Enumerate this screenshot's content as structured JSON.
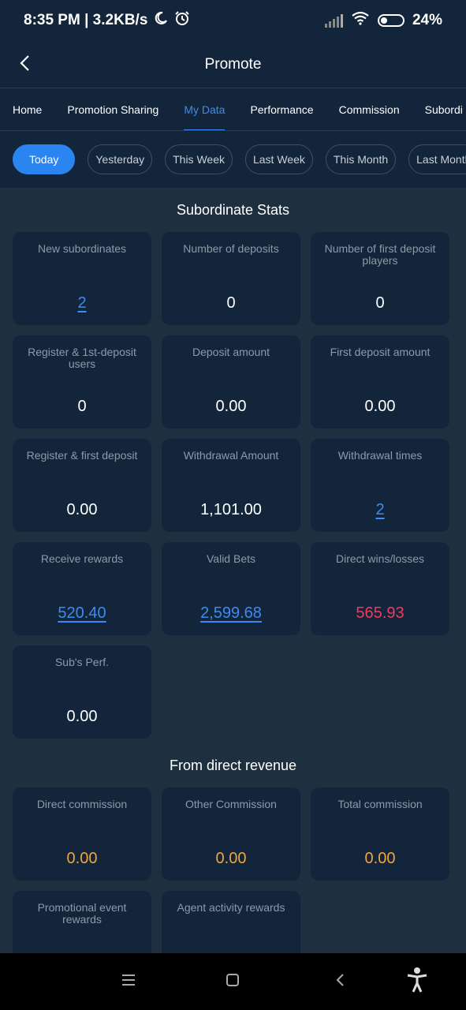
{
  "status_bar": {
    "time_speed": "8:35 PM | 3.2KB/s",
    "battery": "24%",
    "moon_icon": "moon-icon",
    "alarm_icon": "alarm-icon",
    "signal_icon": "signal-icon",
    "wifi_icon": "wifi-icon"
  },
  "header": {
    "title": "Promote"
  },
  "tabs": [
    {
      "label": "Home"
    },
    {
      "label": "Promotion Sharing"
    },
    {
      "label": "My Data",
      "active": true
    },
    {
      "label": "Performance"
    },
    {
      "label": "Commission"
    },
    {
      "label": "Subordi"
    }
  ],
  "filters": [
    {
      "label": "Today",
      "active": true
    },
    {
      "label": "Yesterday"
    },
    {
      "label": "This Week"
    },
    {
      "label": "Last Week"
    },
    {
      "label": "This Month"
    },
    {
      "label": "Last Month"
    }
  ],
  "subordinate_stats": {
    "title": "Subordinate Stats",
    "cards": [
      {
        "label": "New subordinates",
        "value": "2"
      },
      {
        "label": "Number of deposits",
        "value": "0"
      },
      {
        "label": "Number of first deposit players",
        "value": "0"
      },
      {
        "label": "Register & 1st-deposit users",
        "value": "0"
      },
      {
        "label": "Deposit amount",
        "value": "0.00"
      },
      {
        "label": "First deposit amount",
        "value": "0.00"
      },
      {
        "label": "Register & first deposit",
        "value": "0.00"
      },
      {
        "label": "Withdrawal Amount",
        "value": "1,101.00"
      },
      {
        "label": "Withdrawal times",
        "value": "2"
      },
      {
        "label": "Receive rewards",
        "value": "520.40"
      },
      {
        "label": "Valid Bets",
        "value": "2,599.68"
      },
      {
        "label": "Direct wins/losses",
        "value": "565.93"
      },
      {
        "label": "Sub's Perf.",
        "value": "0.00"
      }
    ]
  },
  "direct_revenue": {
    "title": "From direct revenue",
    "cards": [
      {
        "label": "Direct commission",
        "value": "0.00"
      },
      {
        "label": "Other Commission",
        "value": "0.00"
      },
      {
        "label": "Total commission",
        "value": "0.00"
      },
      {
        "label": "Promotional event rewards",
        "value": ""
      },
      {
        "label": "Agent activity rewards",
        "value": ""
      }
    ]
  },
  "colors": {
    "accent": "#3d8bf0",
    "loss_red": "#ef3b5c",
    "commission_orange": "#f2a53a",
    "card_bg": "#13253a",
    "page_bg": "#1e3040"
  },
  "navbar": {
    "menu_icon": "menu-icon",
    "home_icon": "home-square-icon",
    "back_icon": "back-triangle-icon",
    "accessibility_icon": "accessibility-icon"
  }
}
